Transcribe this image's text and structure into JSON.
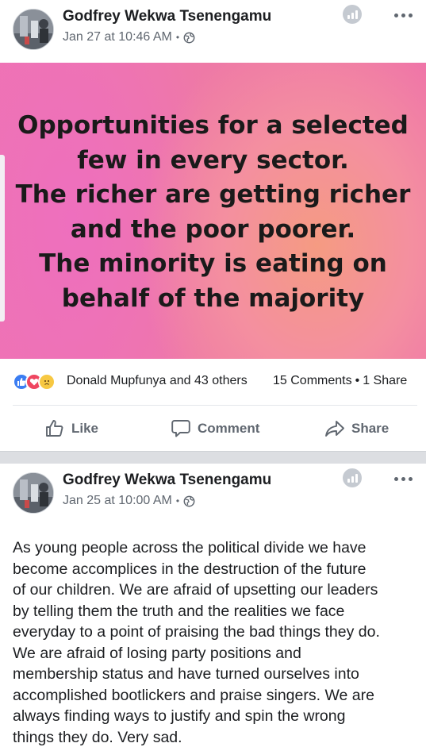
{
  "post1": {
    "author": "Godfrey Wekwa Tsenengamu",
    "timestamp": "Jan 27 at 10:46 AM",
    "audience_icon": "globe-icon",
    "banner_lines": [
      "Opportunities for a selected",
      "few in every sector.",
      "The richer are getting richer",
      "and the poor poorer.",
      "The minority is eating on",
      "behalf of the majority"
    ],
    "reaction_types": [
      "like",
      "love",
      "sad"
    ],
    "reactors": "Donald Mupfunya and 43 others",
    "comments": "15 Comments",
    "shares": "1 Share",
    "actions": {
      "like": "Like",
      "comment": "Comment",
      "share": "Share"
    }
  },
  "post2": {
    "author": "Godfrey Wekwa Tsenengamu",
    "timestamp": "Jan 25 at 10:00 AM",
    "audience_icon": "globe-icon",
    "text_lines": [
      "As young people across the political divide we have",
      "become accomplices in the destruction of the future",
      "of our children. We are afraid of upsetting our leaders",
      "by telling them the truth and the realities we face",
      "everyday to a point of praising  the bad things they do.",
      "We are afraid of losing party positions and",
      "membership status and have turned ourselves into",
      "accomplished bootlickers and praise singers. We are",
      "always finding ways to justify and spin the wrong",
      "things they do. Very sad."
    ]
  },
  "colors": {
    "like_blue": "#3b7df2",
    "love_red": "#ef4660",
    "sad_yellow": "#f7c842",
    "banner_pink": "#ef74b2",
    "banner_orange": "#f59b82"
  }
}
